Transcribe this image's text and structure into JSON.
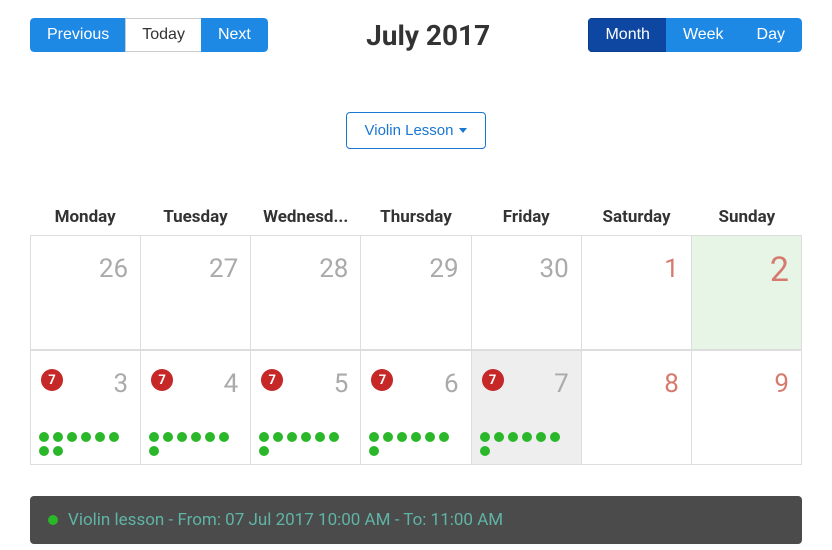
{
  "header": {
    "nav": {
      "previous": "Previous",
      "today": "Today",
      "next": "Next"
    },
    "title": "July 2017",
    "view": {
      "month": "Month",
      "week": "Week",
      "day": "Day",
      "active": "month"
    }
  },
  "filter": {
    "label": "Violin Lesson"
  },
  "weekdays": [
    "Monday",
    "Tuesday",
    "Wednesd...",
    "Thursday",
    "Friday",
    "Saturday",
    "Sunday"
  ],
  "weeks": [
    [
      {
        "day": "26",
        "style": "muted"
      },
      {
        "day": "27",
        "style": "muted"
      },
      {
        "day": "28",
        "style": "muted"
      },
      {
        "day": "29",
        "style": "muted"
      },
      {
        "day": "30",
        "style": "muted"
      },
      {
        "day": "1",
        "style": "red"
      },
      {
        "day": "2",
        "style": "red-big",
        "highlight": "green"
      }
    ],
    [
      {
        "day": "3",
        "style": "muted",
        "badge": "7",
        "dots": 8
      },
      {
        "day": "4",
        "style": "muted",
        "badge": "7",
        "dots": 7
      },
      {
        "day": "5",
        "style": "muted",
        "badge": "7",
        "dots": 7
      },
      {
        "day": "6",
        "style": "muted",
        "badge": "7",
        "dots": 7
      },
      {
        "day": "7",
        "style": "muted",
        "badge": "7",
        "dots": 7,
        "highlight": "grey"
      },
      {
        "day": "8",
        "style": "red"
      },
      {
        "day": "9",
        "style": "red"
      }
    ]
  ],
  "tooltip": "Violin lesson - From: 07 Jul 2017 10:00 AM - To: 11:00 AM"
}
